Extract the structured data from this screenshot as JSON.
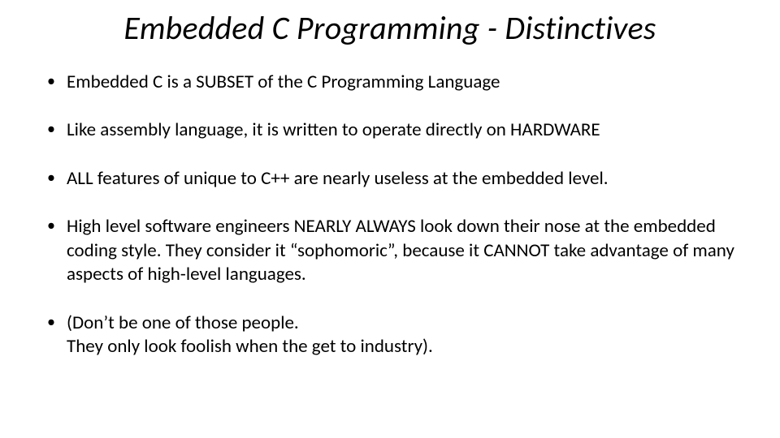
{
  "slide": {
    "title": "Embedded C Programming - Distinctives",
    "bullets": [
      "Embedded C is a SUBSET of the C Programming Language",
      "Like assembly language, it is written to operate directly on HARDWARE",
      "ALL features of unique to C++ are nearly useless at the embedded level.",
      "High level software engineers NEARLY ALWAYS look down their nose at the embedded coding style.  They consider it “sophomoric”, because it CANNOT take advantage of many aspects of high-level languages.",
      "(Don’t be one of those people.\nThey only look foolish when the get to industry)."
    ]
  }
}
